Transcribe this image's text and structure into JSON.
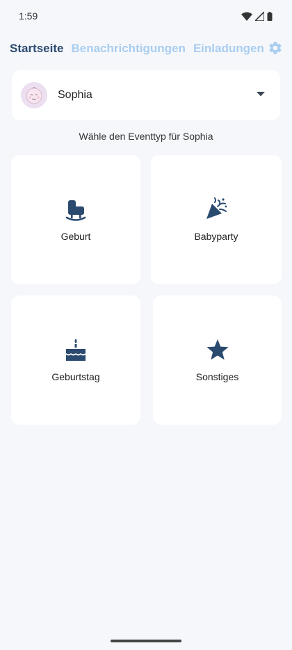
{
  "status_bar": {
    "time": "1:59"
  },
  "tabs": [
    {
      "label": "Startseite",
      "active": true
    },
    {
      "label": "Benachrichtigungen",
      "active": false
    },
    {
      "label": "Einladungen",
      "active": false
    }
  ],
  "profile": {
    "name": "Sophia"
  },
  "prompt": "Wähle den Eventtyp für Sophia",
  "events": [
    {
      "label": "Geburt",
      "icon": "cradle-icon"
    },
    {
      "label": "Babyparty",
      "icon": "party-popper-icon"
    },
    {
      "label": "Geburtstag",
      "icon": "birthday-cake-icon"
    },
    {
      "label": "Sonstiges",
      "icon": "star-icon"
    }
  ],
  "colors": {
    "background": "#f5f7fb",
    "active_tab": "#2b4a6f",
    "inactive_tab": "#a9cdf0",
    "icon": "#2b4a6f"
  }
}
